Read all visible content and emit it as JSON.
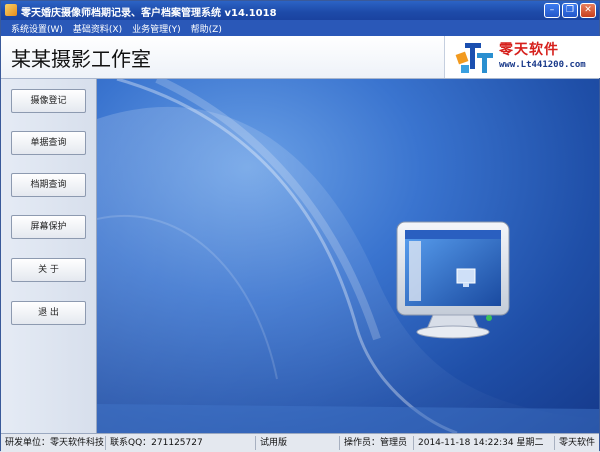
{
  "window": {
    "title": "零天婚庆摄像师档期记录、客户档案管理系统 v14.1018",
    "minimize_icon": "minimize-icon",
    "restore_icon": "restore-icon",
    "close_icon": "close-icon"
  },
  "menu": {
    "items": [
      {
        "label": "系统设置(W)"
      },
      {
        "label": "基础资料(X)"
      },
      {
        "label": "业务管理(Y)"
      },
      {
        "label": "帮助(Z)"
      }
    ]
  },
  "header": {
    "studio_name": "某某摄影工作室",
    "brand": "零天软件",
    "website": "www.Lt441200.com"
  },
  "sidebar": {
    "buttons": [
      {
        "label": "摄像登记"
      },
      {
        "label": "单据查询"
      },
      {
        "label": "档期查询"
      },
      {
        "label": "屏幕保护"
      },
      {
        "label": "关 于"
      },
      {
        "label": "退 出"
      }
    ]
  },
  "status": {
    "developer": "研发单位：零天软件科技",
    "contact": "联系QQ：271125727",
    "edition": "试用版",
    "operator": "操作员：管理员",
    "datetime": "2014-11-18 14:22:34 星期二",
    "vendor": "零天软件"
  },
  "colors": {
    "titlebar": "#1d4aa8",
    "menubar": "#2a58b8",
    "desktop": "#1f4fa8",
    "brand_red": "#d6201c"
  }
}
